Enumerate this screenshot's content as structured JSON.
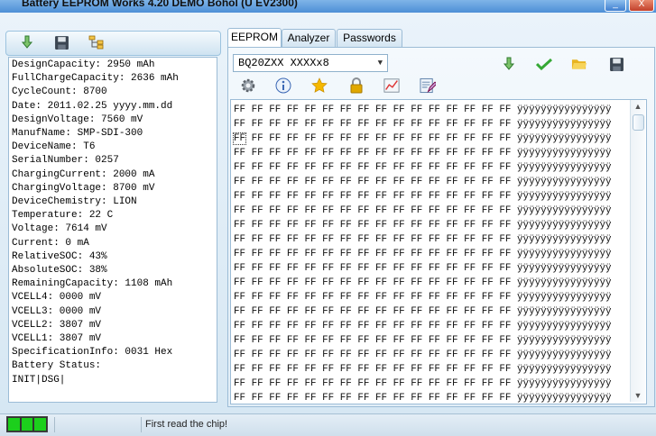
{
  "window": {
    "title": "Battery EEPROM Works  4.20 DEMO Bohol (U EV2300)",
    "minimize_label": "_",
    "close_label": "X"
  },
  "left_toolbar": {
    "icons": [
      "download-arrow-icon",
      "save-disk-icon",
      "tree-structure-icon"
    ]
  },
  "battery_info": {
    "lines": [
      "DesignCapacity: 2950 mAh",
      "FullChargeCapacity: 2636 mAh",
      "CycleCount: 8700",
      "Date: 2011.02.25 yyyy.mm.dd",
      "DesignVoltage: 7560 mV",
      "ManufName: SMP-SDI-300",
      "DeviceName: T6",
      "SerialNumber: 0257",
      "ChargingCurrent: 2000 mA",
      "ChargingVoltage: 8700 mV",
      "DeviceChemistry: LION",
      "Temperature: 22 C",
      "Voltage: 7614 mV",
      "Current: 0 mA",
      "RelativeSOC: 43%",
      "AbsoluteSOC: 38%",
      "RemainingCapacity: 1108 mAh",
      "VCELL4: 0000 mV",
      "VCELL3: 0000 mV",
      "VCELL2: 3807 mV",
      "VCELL1: 3807 mV",
      "SpecificationInfo: 0031 Hex",
      "Battery Status:",
      "INIT|DSG|"
    ]
  },
  "tabs": [
    {
      "label": "EEPROM",
      "active": true
    },
    {
      "label": "Analyzer",
      "active": false
    },
    {
      "label": "Passwords",
      "active": false
    }
  ],
  "chip_select": {
    "value": "BQ20ZXX      XXXXx8",
    "arrow": "▼"
  },
  "right_toolbar": {
    "row1_icons": [
      "download-arrow-icon",
      "check-icon",
      "open-folder-icon",
      "save-disk-icon"
    ],
    "row2_icons": [
      "gear-icon",
      "info-icon",
      "star-icon",
      "lock-icon",
      "chart-icon",
      "edit-icon"
    ]
  },
  "hex_view": {
    "bytes_per_row": 16,
    "row_count": 21,
    "byte_value": "FF",
    "ascii": "ÿÿÿÿÿÿÿÿÿÿÿÿÿÿÿÿ",
    "selected_row": 2,
    "selected_col": 0
  },
  "scrollbar": {
    "up": "▲",
    "down": "▼"
  },
  "status": {
    "message": "First read the chip!",
    "led_count": 3,
    "led_color": "#1ccf1c"
  },
  "colors": {
    "titlebar": "#4d8fd6",
    "panel_border": "#9cbcd6",
    "download_green": "#2f9e2f",
    "check_green": "#35a835",
    "folder_yellow": "#f0c419",
    "star_yellow": "#f5b800",
    "lock_gold": "#e0a800"
  }
}
